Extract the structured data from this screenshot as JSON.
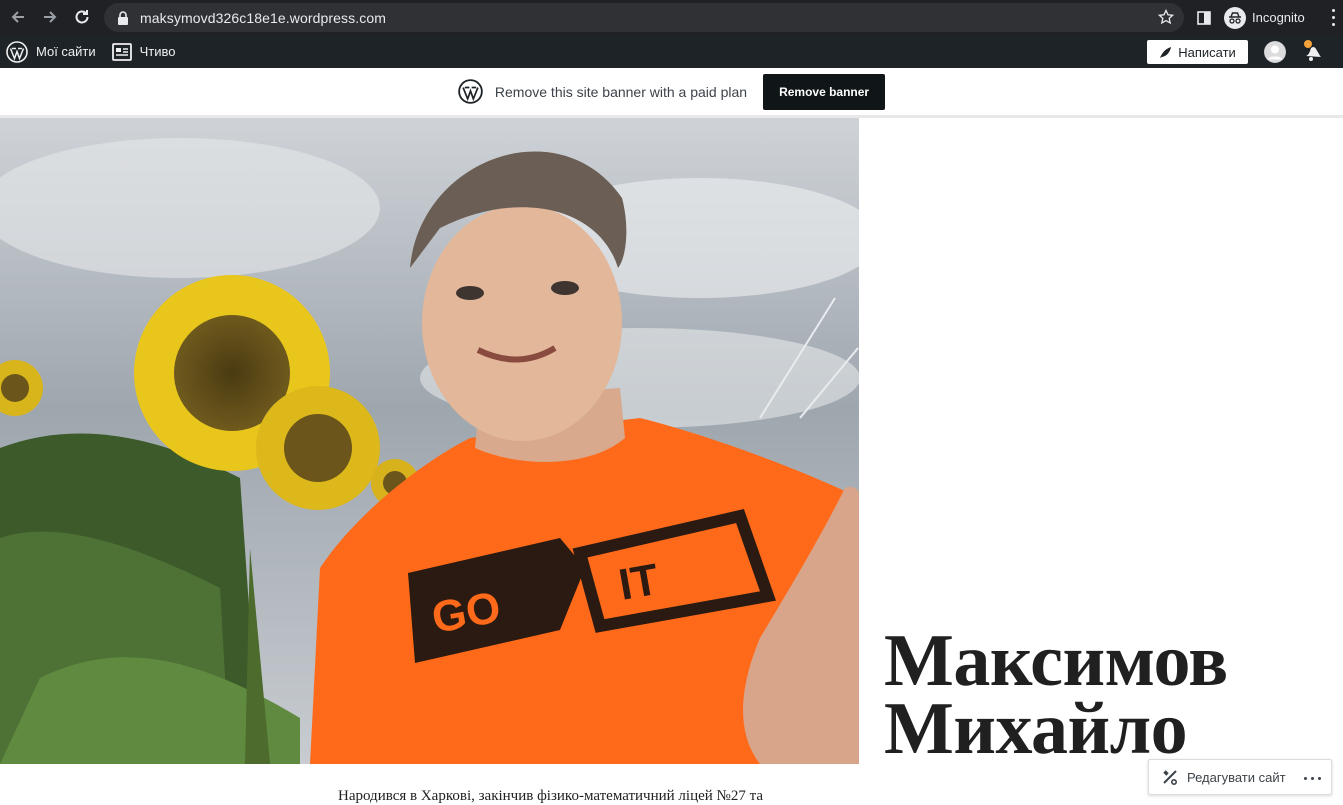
{
  "browser": {
    "url": "maksymovd326c18e1e.wordpress.com",
    "incognito_label": "Incognito"
  },
  "adminbar": {
    "my_sites": "Мої сайти",
    "reader": "Чтиво",
    "write": "Написати"
  },
  "banner": {
    "text": "Remove this site banner with a paid plan",
    "button": "Remove banner"
  },
  "site": {
    "title_line1": "Максимов",
    "title_line2": "Михайло",
    "bio_start": "Народився в Харкові, закінчив фізико-математичний ліцей №27 та",
    "shirt_text_1": "GO",
    "shirt_text_2": "IT"
  },
  "edit": {
    "label": "Редагувати сайт"
  },
  "colors": {
    "chrome_bg": "#202124",
    "adminbar_bg": "#1d2327",
    "banner_button_bg": "#101517",
    "notification_dot": "#f6a33b",
    "shirt_orange": "#ff6a1a"
  }
}
